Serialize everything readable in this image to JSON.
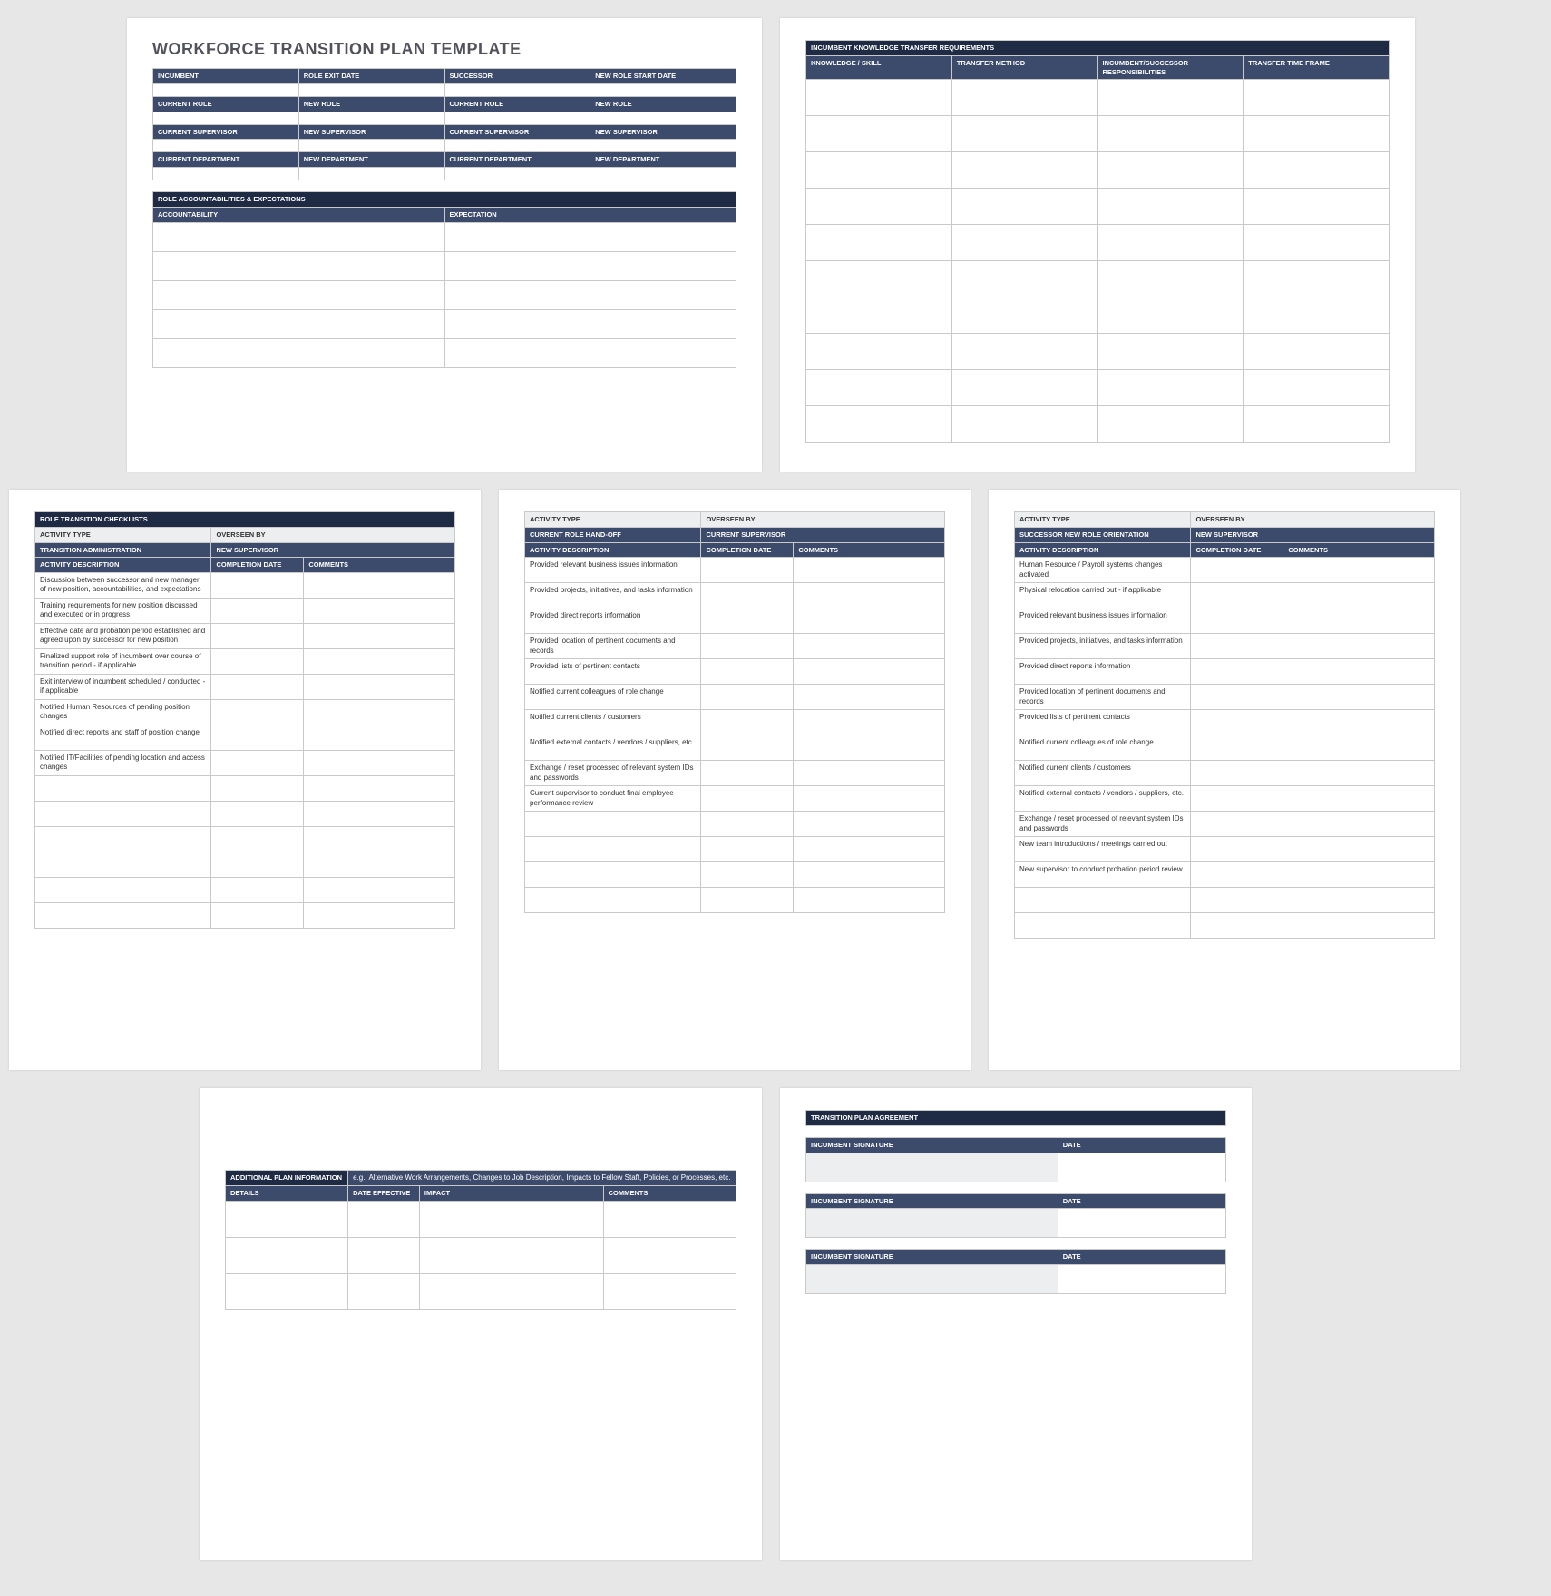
{
  "page1": {
    "title": "WORKFORCE TRANSITION PLAN TEMPLATE",
    "basic_headers_row1": [
      "INCUMBENT",
      "ROLE EXIT DATE",
      "SUCCESSOR",
      "NEW ROLE START DATE"
    ],
    "basic_headers_row2": [
      "CURRENT ROLE",
      "NEW ROLE",
      "CURRENT ROLE",
      "NEW ROLE"
    ],
    "basic_headers_row3": [
      "CURRENT SUPERVISOR",
      "NEW SUPERVISOR",
      "CURRENT SUPERVISOR",
      "NEW SUPERVISOR"
    ],
    "basic_headers_row4": [
      "CURRENT DEPARTMENT",
      "NEW DEPARTMENT",
      "CURRENT DEPARTMENT",
      "NEW DEPARTMENT"
    ],
    "acct_section": "ROLE ACCOUNTABILITIES & EXPECTATIONS",
    "acct_headers": [
      "ACCOUNTABILITY",
      "EXPECTATION"
    ]
  },
  "page2": {
    "section": "INCUMBENT KNOWLEDGE TRANSFER REQUIREMENTS",
    "headers": [
      "KNOWLEDGE / SKILL",
      "TRANSFER METHOD",
      "INCUMBENT/SUCCESSOR RESPONSIBILITIES",
      "TRANSFER TIME FRAME"
    ]
  },
  "page3": {
    "section": "ROLE TRANSITION CHECKLISTS",
    "row_a": [
      "ACTIVITY TYPE",
      "OVERSEEN BY"
    ],
    "row_b": [
      "TRANSITION ADMINISTRATION",
      "NEW SUPERVISOR"
    ],
    "cols": [
      "ACTIVITY DESCRIPTION",
      "COMPLETION DATE",
      "COMMENTS"
    ],
    "items": [
      "Discussion between successor and new manager of new position, accountabilities, and expectations",
      "Training requirements for new position discussed and executed or in progress",
      "Effective date and probation period established and agreed upon by successor for new position",
      "Finalized support role of incumbent over course of transition period - if applicable",
      "Exit interview of incumbent scheduled / conducted - if applicable",
      "Notified Human Resources of pending position changes",
      "Notified direct reports and staff of position change",
      "Notified IT/Facilities of pending location and access changes"
    ]
  },
  "page4": {
    "row_a": [
      "ACTIVITY TYPE",
      "OVERSEEN BY"
    ],
    "row_b": [
      "CURRENT ROLE HAND-OFF",
      "CURRENT SUPERVISOR"
    ],
    "cols": [
      "ACTIVITY DESCRIPTION",
      "COMPLETION DATE",
      "COMMENTS"
    ],
    "items": [
      "Provided relevant business issues information",
      "Provided projects, initiatives, and tasks information",
      "Provided direct reports information",
      "Provided location of pertinent documents and records",
      "Provided lists of pertinent contacts",
      "Notified current colleagues of role change",
      "Notified current clients / customers",
      "Notified external contacts / vendors / suppliers, etc.",
      "Exchange / reset processed of relevant system IDs and passwords",
      "Current supervisor to conduct final employee performance review"
    ]
  },
  "page5": {
    "row_a": [
      "ACTIVITY TYPE",
      "OVERSEEN BY"
    ],
    "row_b": [
      "SUCCESSOR NEW ROLE ORIENTATION",
      "NEW SUPERVISOR"
    ],
    "cols": [
      "ACTIVITY DESCRIPTION",
      "COMPLETION DATE",
      "COMMENTS"
    ],
    "items": [
      "Human Resource / Payroll systems changes activated",
      "Physical relocation carried out - if applicable",
      "Provided relevant business issues information",
      "Provided projects, initiatives, and tasks information",
      "Provided direct reports information",
      "Provided location of pertinent documents and records",
      "Provided lists of pertinent contacts",
      "Notified current colleagues of role change",
      "Notified current clients / customers",
      "Notified external contacts / vendors / suppliers, etc.",
      "Exchange / reset processed of relevant system IDs and passwords",
      "New team introductions / meetings carried out",
      "New supervisor to conduct probation period review"
    ]
  },
  "page6": {
    "section": "ADDITIONAL PLAN INFORMATION",
    "note": "e.g., Alternative Work Arrangements, Changes to Job Description, Impacts to Fellow Staff, Policies, or Processes, etc.",
    "headers": [
      "DETAILS",
      "DATE EFFECTIVE",
      "IMPACT",
      "COMMENTS"
    ]
  },
  "page7": {
    "section": "TRANSITION PLAN AGREEMENT",
    "sig_label": "INCUMBENT SIGNATURE",
    "date_label": "DATE"
  }
}
